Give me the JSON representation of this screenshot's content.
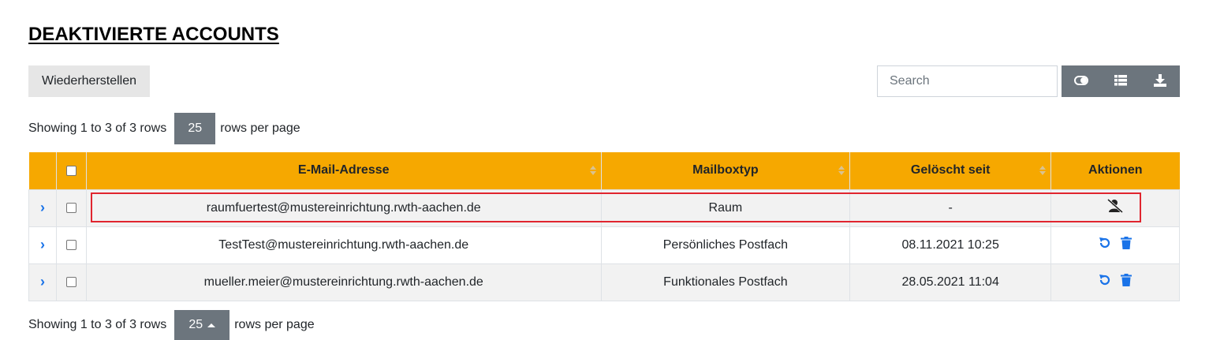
{
  "page": {
    "title": "DEAKTIVIERTE ACCOUNTS"
  },
  "toolbar": {
    "restore_label": "Wiederherstellen",
    "search_placeholder": "Search",
    "icons": [
      "toggle-icon",
      "list-columns-icon",
      "download-icon"
    ]
  },
  "pagination": {
    "info": "Showing 1 to 3 of 3 rows",
    "page_size": "25",
    "suffix": "rows per page"
  },
  "table": {
    "headers": {
      "email": "E-Mail-Adresse",
      "mailbox_type": "Mailboxtyp",
      "deleted_since": "Gelöscht seit",
      "actions": "Aktionen"
    },
    "rows": [
      {
        "email": "raumfuertest@mustereinrichtung.rwth-aachen.de",
        "mailbox_type": "Raum",
        "deleted_since": "-",
        "actions": [
          "user-slash-icon"
        ]
      },
      {
        "email": "TestTest@mustereinrichtung.rwth-aachen.de",
        "mailbox_type": "Persönliches Postfach",
        "deleted_since": "08.11.2021 10:25",
        "actions": [
          "undo-icon",
          "trash-icon"
        ]
      },
      {
        "email": "mueller.meier@mustereinrichtung.rwth-aachen.de",
        "mailbox_type": "Funktionales Postfach",
        "deleted_since": "28.05.2021 11:04",
        "actions": [
          "undo-icon",
          "trash-icon"
        ]
      }
    ]
  },
  "colors": {
    "header_bg": "#f6a800",
    "accent_blue": "#1a73e8",
    "button_gray": "#6c757d",
    "highlight_red": "#e0252f"
  }
}
